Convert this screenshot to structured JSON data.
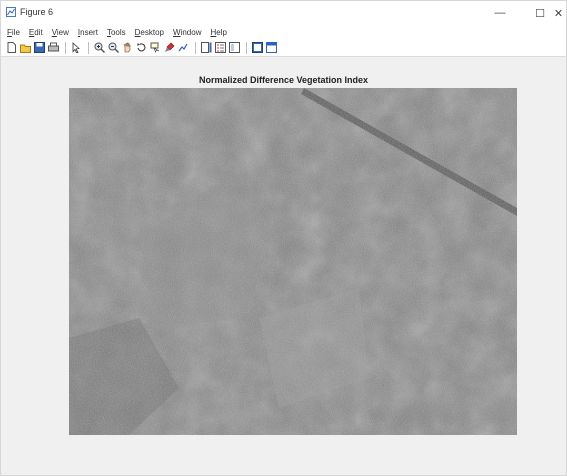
{
  "window": {
    "title": "Figure 6",
    "minimize_glyph": "—",
    "maximize_glyph": "☐",
    "close_glyph": "✕"
  },
  "menu": [
    {
      "first": "F",
      "rest": "ile"
    },
    {
      "first": "E",
      "rest": "dit"
    },
    {
      "first": "V",
      "rest": "iew"
    },
    {
      "first": "I",
      "rest": "nsert"
    },
    {
      "first": "T",
      "rest": "ools"
    },
    {
      "first": "D",
      "rest": "esktop"
    },
    {
      "first": "W",
      "rest": "indow"
    },
    {
      "first": "H",
      "rest": "elp"
    }
  ],
  "toolbar": {
    "icons": [
      "new-figure-icon",
      "open-file-icon",
      "save-figure-icon",
      "print-figure-icon",
      "edit-plot-icon",
      "zoom-in-icon",
      "zoom-out-icon",
      "pan-icon",
      "rotate-3d-icon",
      "data-cursor-icon",
      "brush-icon",
      "link-plot-icon",
      "insert-colorbar-icon",
      "insert-legend-icon",
      "hide-plot-tools-icon",
      "show-plot-tools-icon"
    ]
  },
  "figure": {
    "title": "Normalized Difference Vegetation Index",
    "image_description": "grayscale ndvi image"
  },
  "colors": {
    "window_bg": "#f0f0f0",
    "toolbar_bg": "#ffffff"
  }
}
